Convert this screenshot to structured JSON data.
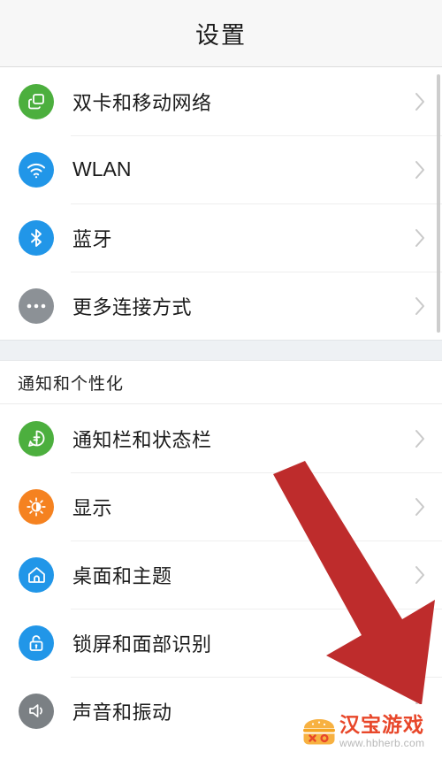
{
  "header": {
    "title": "设置"
  },
  "colors": {
    "green": "#4CAF3E",
    "blue": "#2196E8",
    "gray": "#7B8084",
    "orange": "#F58220",
    "arrow_red": "#BE2C2C",
    "chevron": "#C9C9C9",
    "titlebar_bg": "#F7F7F7",
    "section_gap_bg": "#EEF1F4",
    "watermark_red": "#E8472A",
    "watermark_orange": "#F7B141"
  },
  "sections": [
    {
      "name": "connectivity",
      "label": "",
      "rows": [
        {
          "label": "双卡和移动网络",
          "icon": "sim-cards-icon",
          "icon_color": "#4CAF3E",
          "script": "cjk"
        },
        {
          "label": "WLAN",
          "icon": "wifi-icon",
          "icon_color": "#2196E8",
          "script": "latin"
        },
        {
          "label": "蓝牙",
          "icon": "bluetooth-icon",
          "icon_color": "#2196E8",
          "script": "cjk"
        },
        {
          "label": "更多连接方式",
          "icon": "more-dots-icon",
          "icon_color": "#8C9196",
          "script": "cjk"
        }
      ]
    },
    {
      "name": "notifications-personalization",
      "label": "通知和个性化",
      "rows": [
        {
          "label": "通知栏和状态栏",
          "icon": "notification-chat-icon",
          "icon_color": "#4CAF3E",
          "script": "cjk"
        },
        {
          "label": "显示",
          "icon": "brightness-icon",
          "icon_color": "#F58220",
          "script": "cjk"
        },
        {
          "label": "桌面和主题",
          "icon": "home-icon",
          "icon_color": "#2196E8",
          "script": "cjk"
        },
        {
          "label": "锁屏和面部识别",
          "icon": "lock-icon",
          "icon_color": "#2196E8",
          "script": "cjk"
        },
        {
          "label": "声音和振动",
          "icon": "sound-icon",
          "icon_color": "#7B8084",
          "script": "cjk"
        }
      ]
    }
  ],
  "annotation": {
    "arrow": "red-down-right-arrow",
    "color": "#BE2C2C"
  },
  "watermark": {
    "brand": "汉宝游戏",
    "url": "www.hbherb.com",
    "logo": "burger-logo-icon"
  },
  "scrollbar": {
    "name": "vertical-scrollbar"
  }
}
